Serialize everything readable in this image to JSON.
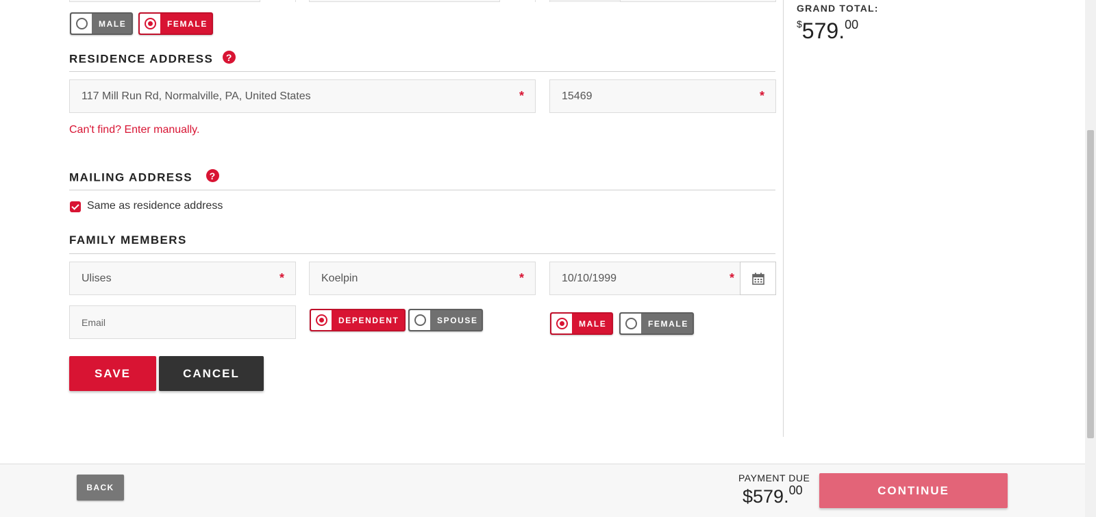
{
  "gender_top": {
    "male_label": "MALE",
    "female_label": "FEMALE",
    "selected": "female"
  },
  "residence": {
    "title": "RESIDENCE ADDRESS",
    "address_value": "117 Mill Run Rd, Normalville, PA, United States",
    "zip_value": "15469",
    "manual_link": "Can't find? Enter manually."
  },
  "mailing": {
    "title": "MAILING ADDRESS",
    "same_as_label": "Same as residence address",
    "same_as_checked": true
  },
  "family": {
    "title": "FAMILY MEMBERS",
    "first_name": "Ulises",
    "last_name": "Koelpin",
    "dob": "10/10/1999",
    "email_placeholder": "Email",
    "relation": {
      "dependent_label": "DEPENDENT",
      "spouse_label": "SPOUSE",
      "selected": "dependent"
    },
    "gender": {
      "male_label": "MALE",
      "female_label": "FEMALE",
      "selected": "male"
    },
    "save_label": "SAVE",
    "cancel_label": "CANCEL"
  },
  "summary": {
    "grand_total_label": "GRAND TOTAL:",
    "currency": "$",
    "grand_total_whole": "579.",
    "grand_total_cents": "00"
  },
  "footer": {
    "back_label": "BACK",
    "payment_due_label": "PAYMENT DUE",
    "payment_due_amount": "$579.",
    "payment_due_cents": "00",
    "continue_label": "CONTINUE"
  },
  "colors": {
    "accent": "#d81433",
    "neutral": "#707070",
    "dark": "#333333",
    "continue": "#e36478"
  }
}
